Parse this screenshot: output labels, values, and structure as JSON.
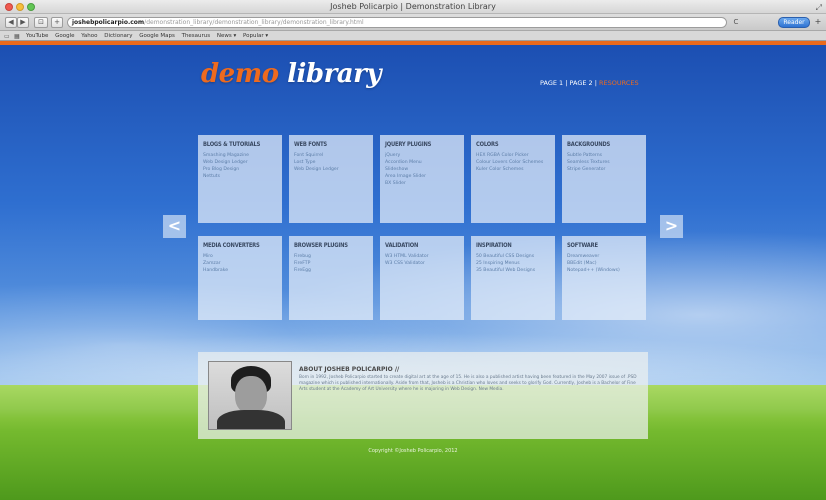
{
  "window": {
    "title": "Josheb Policarpio | Demonstration Library"
  },
  "toolbar": {
    "back": "◀",
    "forward": "▶",
    "screen": "⊡",
    "plus": "+",
    "address_host": "joshebpolicarpio.com",
    "address_path": "/demonstration_library/demonstration_library/demonstration_library.html",
    "reload": "C",
    "reader_label": "Reader",
    "add": "+"
  },
  "bookmarks": {
    "items": [
      "YouTube",
      "Google",
      "Yahoo",
      "Dictionary",
      "Google Maps",
      "Thesaurus",
      "News ▾",
      "Popular ▾"
    ]
  },
  "site": {
    "logo_main": "demo",
    "logo_second": "library"
  },
  "nav": {
    "page1": "PAGE 1",
    "sep1": " | ",
    "page2": "PAGE 2",
    "sep2": " | ",
    "resources": "RESOURCES"
  },
  "arrows": {
    "left": "<",
    "right": ">"
  },
  "cards": [
    {
      "title": "BLOGS & TUTORIALS",
      "links": [
        "Smashing Magazine",
        "Web Design Ledger",
        "Pro Blog Design",
        "Nettuts"
      ]
    },
    {
      "title": "WEB FONTS",
      "links": [
        "Font Squirrel",
        "Lost Type",
        "Web Design Ledger"
      ]
    },
    {
      "title": "JQUERY PLUGINS",
      "links": [
        "jQuery",
        "Accordion Menu",
        "Slideshow",
        "Area Image Slider",
        "BX Slider"
      ]
    },
    {
      "title": "COLORS",
      "links": [
        "HEX RGBA Color Picker",
        "Colour Lovers Color Schemes",
        "Kuler Color Schemes"
      ]
    },
    {
      "title": "BACKGROUNDS",
      "links": [
        "Subtle Patterns",
        "Seamless Textures",
        "Stripe Generator"
      ]
    },
    {
      "title": "MEDIA CONVERTERS",
      "links": [
        "Miro",
        "Zamzar",
        "Handbrake"
      ]
    },
    {
      "title": "BROWSER PLUGINS",
      "links": [
        "Firebug",
        "FireFTP",
        "FireEgg"
      ]
    },
    {
      "title": "VALIDATION",
      "links": [
        "W3 HTML Validator",
        "W3 CSS Validator"
      ]
    },
    {
      "title": "INSPIRATION",
      "links": [
        "50 Beautiful CSS Designs",
        "25 Inspiring Menus",
        "35 Beautiful Web Designs"
      ]
    },
    {
      "title": "SOFTWARE",
      "links": [
        "Dreamweaver",
        "BBEdit (Mac)",
        "Notepad++ (Windows)"
      ]
    }
  ],
  "about": {
    "title": "ABOUT JOSHEB POLICARPIO //",
    "text": "Born in 1992, Josheb Policarpio started to create digital art at the age of 15. He is also a published artist having been featured in the May 2007 issue of .PSD magazine which is published internationally. Aside from that, Josheb is a Christian who loves and seeks to glorify God. Currently, Josheb is a Bachelor of Fine Arts student at the Academy of Art University where he is majoring in Web Design. New Media."
  },
  "footer": {
    "copyright": "Copyright ©Josheb Policarpio, 2012"
  }
}
